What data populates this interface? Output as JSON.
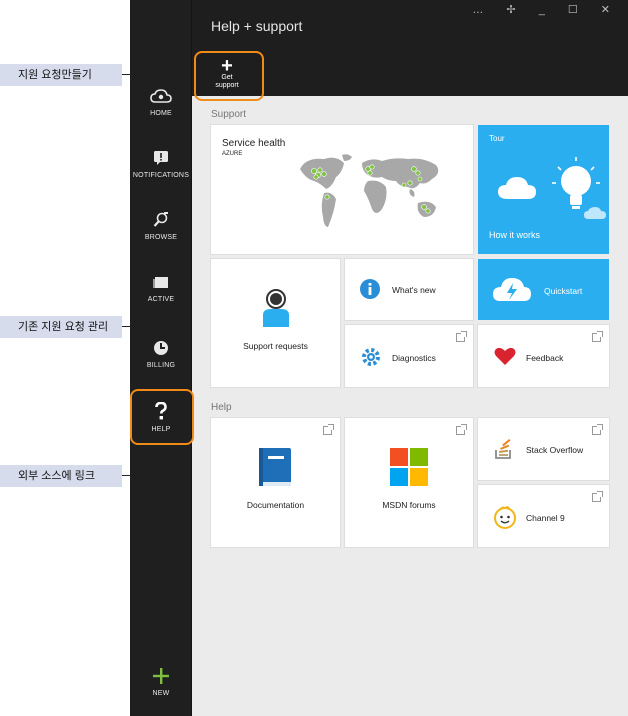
{
  "callouts": {
    "create_request": "지원 요청만들기",
    "manage_requests": "기존 지원 요청 관리",
    "external_links": "외부 소스에 링크"
  },
  "window": {
    "title": "Help + support",
    "controls": "… ✢ _ ☐ ✕"
  },
  "command_bar": {
    "get_support": "Get",
    "get_support_2": "support"
  },
  "sidebar": {
    "items": [
      {
        "label": "HOME",
        "icon": "cloud-icon"
      },
      {
        "label": "NOTIFICATIONS",
        "icon": "notification-icon"
      },
      {
        "label": "BROWSE",
        "icon": "browse-icon"
      },
      {
        "label": "ACTIVE",
        "icon": "active-icon"
      },
      {
        "label": "BILLING",
        "icon": "billing-icon"
      },
      {
        "label": "HELP",
        "icon": "help-icon"
      }
    ],
    "new_label": "NEW"
  },
  "sections": {
    "support": "Support",
    "help": "Help"
  },
  "tiles": {
    "service_health": "Service health",
    "service_health_sub": "AZURE",
    "tour": "Tour",
    "how_it_works": "How it works",
    "whats_new": "What's new",
    "quickstart": "Quickstart",
    "support_requests": "Support requests",
    "diagnostics": "Diagnostics",
    "feedback": "Feedback",
    "documentation": "Documentation",
    "msdn_forums": "MSDN forums",
    "stack_overflow": "Stack Overflow",
    "channel9": "Channel 9"
  },
  "colors": {
    "accent_blue": "#2aaef0",
    "highlight_orange": "#f28a17",
    "new_green": "#7fbf3f",
    "health_green": "#7cc53e"
  }
}
